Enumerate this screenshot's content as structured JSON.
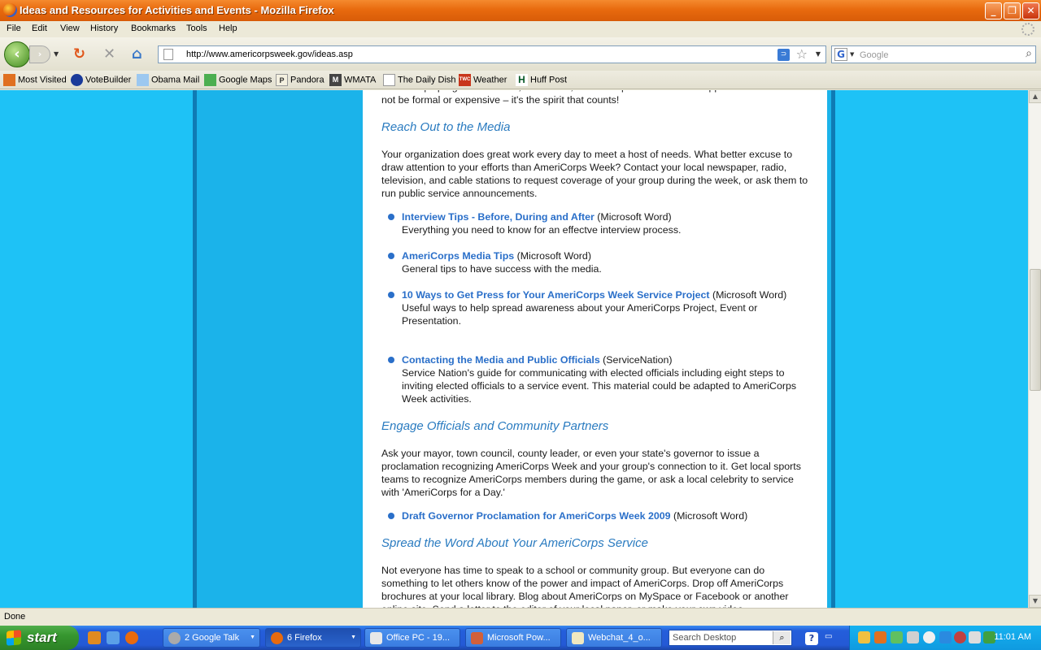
{
  "window": {
    "title": "Ideas and Resources for Activities and Events - Mozilla Firefox",
    "minimize": "_",
    "maximize": "❐",
    "close": "✕"
  },
  "menu": [
    "File",
    "Edit",
    "View",
    "History",
    "Bookmarks",
    "Tools",
    "Help"
  ],
  "nav": {
    "url": "http://www.americorpsweek.gov/ideas.asp",
    "search_placeholder": "Google",
    "search_engine_letter": "G",
    "rss": "⊃"
  },
  "bookmarks": [
    "Most Visited",
    "VoteBuilder",
    "Obama Mail",
    "Google Maps",
    "Pandora",
    "WMATA",
    "The Daily Dish",
    "Weather",
    "Huff Post"
  ],
  "bookmark_badges": [
    "",
    "",
    "",
    "",
    "P",
    "M",
    "",
    "TWC",
    "H"
  ],
  "content": {
    "top_text": "AmeriCorps program's funders, volunteers, and other partners for their support. The events need not be formal or expensive – it's the spirit that counts!",
    "sections": [
      {
        "heading": "Reach Out to the Media",
        "intro": "Your organization does great work every day to meet a host of needs. What better excuse to draw attention to your efforts than AmeriCorps Week? Contact your local newspaper, radio, television, and cable stations to request coverage of your group during the week, or ask them to run public service announcements.",
        "items": [
          {
            "link": "Interview Tips - Before, During and After",
            "type": " (Microsoft Word)",
            "desc": "Everything you need to know for an effectve interview process."
          },
          {
            "link": "AmeriCorps Media Tips",
            "type": " (Microsoft Word)",
            "desc": "General tips to have success with the media."
          },
          {
            "link": "10 Ways to Get Press for Your AmeriCorps Week Service Project",
            "type": " (Microsoft Word)",
            "desc": "Useful ways to help spread awareness about your AmeriCorps Project, Event or Presentation."
          },
          {
            "link": "Contacting the Media and Public Officials",
            "type": " (ServiceNation)",
            "desc": "Service Nation's guide for communicating with elected officials including eight steps to inviting elected officials to a service event. This material could be adapted to AmeriCorps Week activities."
          }
        ]
      },
      {
        "heading": "Engage Officials and Community Partners",
        "intro": "Ask your mayor, town council, county leader, or even your state's governor to issue a proclamation recognizing AmeriCorps Week and your group's connection to it. Get local sports teams to recognize AmeriCorps members during the game, or ask a local celebrity to service with 'AmeriCorps for a Day.'",
        "items": [
          {
            "link": "Draft Governor Proclamation for AmeriCorps Week 2009",
            "type": " (Microsoft Word)",
            "desc": ""
          }
        ]
      },
      {
        "heading": "Spread the Word About Your AmeriCorps Service",
        "intro": "Not everyone has time to speak to a school or community group. But everyone can do something to let others know of the power and impact of AmeriCorps. Drop off AmeriCorps brochures at your local library. Blog about AmeriCorps on MySpace or Facebook or another online site. Send a letter to the editor of your local paper, or make your own video."
      }
    ]
  },
  "status": "Done",
  "taskbar": {
    "start": "start",
    "tasks": [
      "2 Google Talk",
      "6 Firefox",
      "Office PC - 19...",
      "Microsoft Pow...",
      "Webchat_4_o..."
    ],
    "desktop_search_placeholder": "Search Desktop",
    "clock": "11:01 AM"
  },
  "colors": {
    "page_bg": "#1ec2f6",
    "heading": "#2a7bc0",
    "link": "#2a6fc9",
    "titlebar": "#e86a0e"
  }
}
